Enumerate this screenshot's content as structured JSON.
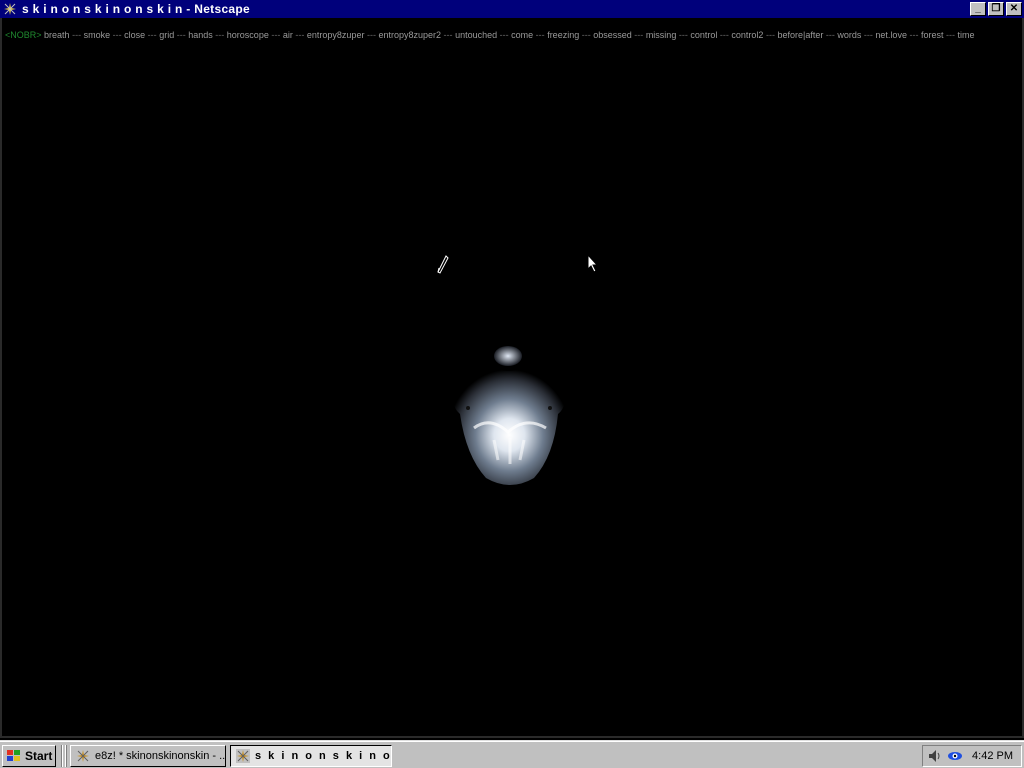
{
  "window": {
    "title": "s k i n o n s k i n o n s k i n - Netscape",
    "minimize_glyph": "_",
    "restore_glyph": "❐",
    "close_glyph": "✕"
  },
  "page": {
    "nobr_tag": "<NOBR>",
    "separator": "---",
    "links": [
      "breath",
      "smoke",
      "close",
      "grid",
      "hands",
      "horoscope",
      "air",
      "entropy8zuper",
      "entropy8zuper2",
      "untouched",
      "come",
      "freezing",
      "obsessed",
      "missing",
      "control",
      "control2",
      "before|after",
      "words",
      "net.love",
      "forest",
      "time"
    ],
    "image_icon": "glowing-torso-image"
  },
  "taskbar": {
    "start_label": "Start",
    "tasks": [
      {
        "label": "e8z! * skinonskinonskin - ...",
        "active": false
      },
      {
        "label": "s k i n o n s k i n o n ...",
        "active": true
      }
    ],
    "clock": "4:42 PM"
  },
  "colors": {
    "titlebar": "#00007b",
    "nobr_tag": "#1f8a2f",
    "link_text": "#9a9a9a",
    "page_bg": "#000000"
  }
}
